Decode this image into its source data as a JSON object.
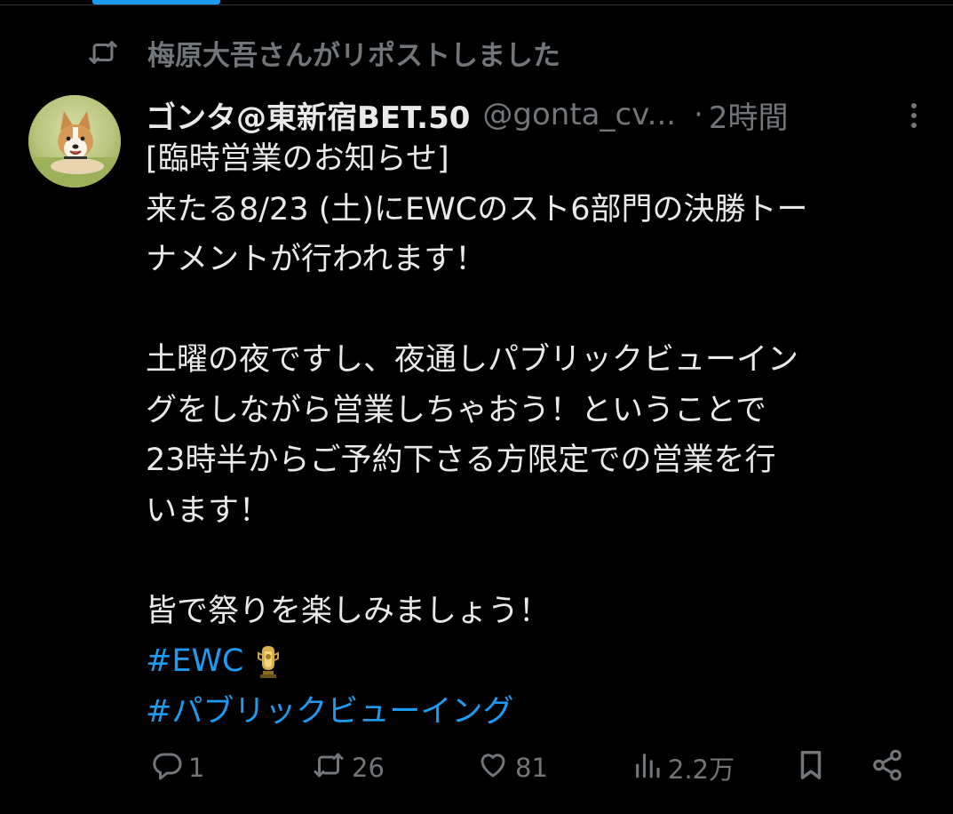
{
  "repost": {
    "icon": "repost-icon",
    "text": "梅原大吾さんがリポストしました"
  },
  "author": {
    "avatar_icon": "corgi-avatar",
    "display_name": "ゴンタ@東新宿BET.50",
    "handle": "@gonta_cv...",
    "separator": "·",
    "time": "2時間"
  },
  "post": {
    "lines": {
      "l1": "[臨時営業のお知らせ]",
      "l2": "来たる8/23 (土)にEWCのスト6部門の決勝トー",
      "l3": "ナメントが行われます！",
      "l4": "土曜の夜ですし、夜通しパブリックビューイン",
      "l5": "グをしながら営業しちゃおう！ということで",
      "l6": "23時半からご予約下さる方限定での営業を行",
      "l7": "います！",
      "l8": "皆で祭りを楽しみましょう！"
    },
    "hashtags": {
      "h1": "#EWC",
      "h2": "#パブリックビューイング"
    },
    "hashtag_emoji_icon": "trophy-icon"
  },
  "actions": {
    "reply": {
      "icon": "reply-icon",
      "count": "1"
    },
    "repost": {
      "icon": "repost-icon",
      "count": "26"
    },
    "like": {
      "icon": "heart-icon",
      "count": "81"
    },
    "views": {
      "icon": "views-icon",
      "count": "2.2万"
    },
    "bookmark": {
      "icon": "bookmark-icon"
    },
    "share": {
      "icon": "share-icon"
    }
  },
  "colors": {
    "background": "#000000",
    "text_primary": "#e7e9ea",
    "text_secondary": "#71767b",
    "accent": "#1d9bf0"
  }
}
